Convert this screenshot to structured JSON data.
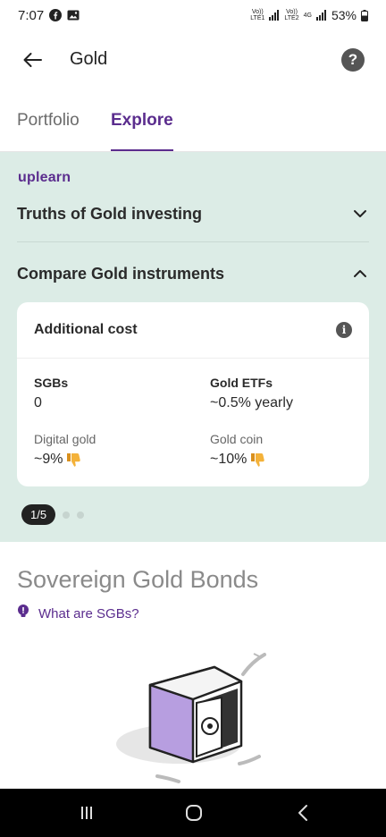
{
  "status_bar": {
    "time": "7:07",
    "net1_top": "Vo))",
    "net1_bottom": "LTE1",
    "net2_top": "Vo))",
    "net2_bottom": "LTE2",
    "net2_type": "4G",
    "battery": "53%",
    "icons": [
      "facebook-icon",
      "gallery-icon",
      "signal-icon",
      "signal-icon",
      "battery-icon"
    ]
  },
  "app_bar": {
    "title": "Gold",
    "back_icon": "arrow-left-icon",
    "help_label": "?"
  },
  "tabs": [
    {
      "label": "Portfolio",
      "active": false
    },
    {
      "label": "Explore",
      "active": true
    }
  ],
  "learn": {
    "brand": "uplearn",
    "accordions": [
      {
        "title": "Truths of Gold investing",
        "expanded": false
      },
      {
        "title": "Compare Gold instruments",
        "expanded": true
      }
    ],
    "card": {
      "title": "Additional cost",
      "info_label": "i",
      "cells": [
        {
          "label": "SGBs",
          "value": "0"
        },
        {
          "label": "Gold ETFs",
          "value": "~0.5% yearly"
        },
        {
          "label": "Digital gold",
          "value": "~9%"
        },
        {
          "label": "Gold coin",
          "value": "~10%"
        }
      ]
    },
    "pager": {
      "label": "1/5"
    }
  },
  "sgb": {
    "title": "Sovereign Gold Bonds",
    "link": "What are SGBs?"
  },
  "colors": {
    "accent": "#5b2d8e",
    "section_bg": "#dcece6",
    "nav_bg": "#000000"
  }
}
